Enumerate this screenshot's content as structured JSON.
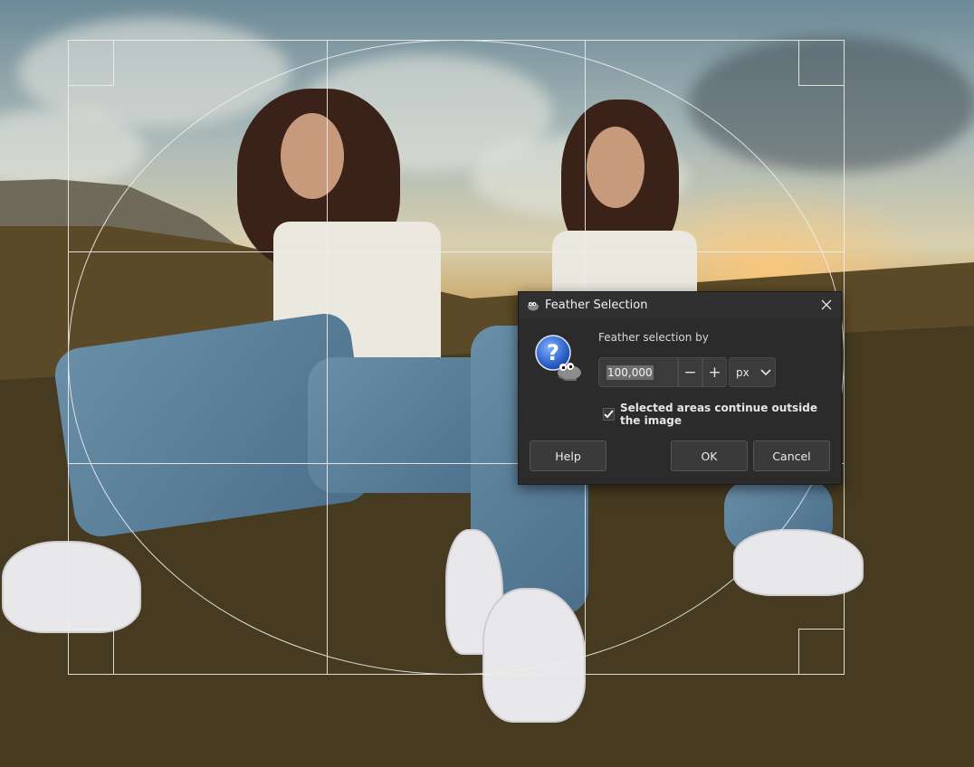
{
  "dialog": {
    "title": "Feather Selection",
    "feather_label": "Feather selection by",
    "feather_value": "100,000",
    "unit": "px",
    "minus_symbol": "−",
    "plus_symbol": "+",
    "checkbox_label": "Selected areas continue outside the image",
    "checkbox_checked": true,
    "help_label": "Help",
    "ok_label": "OK",
    "cancel_label": "Cancel"
  },
  "icons": {
    "title": "gimp-wilber-icon",
    "close": "close-icon",
    "dialog": "question-help-icon",
    "unit_dropdown": "chevron-down-icon",
    "checkbox": "checkmark-icon"
  },
  "colors": {
    "dialog_bg": "#2b2b2b",
    "titlebar_bg": "#303030",
    "help_icon_blue": "#2f6fd6",
    "guide_line": "#e6e6e6"
  }
}
